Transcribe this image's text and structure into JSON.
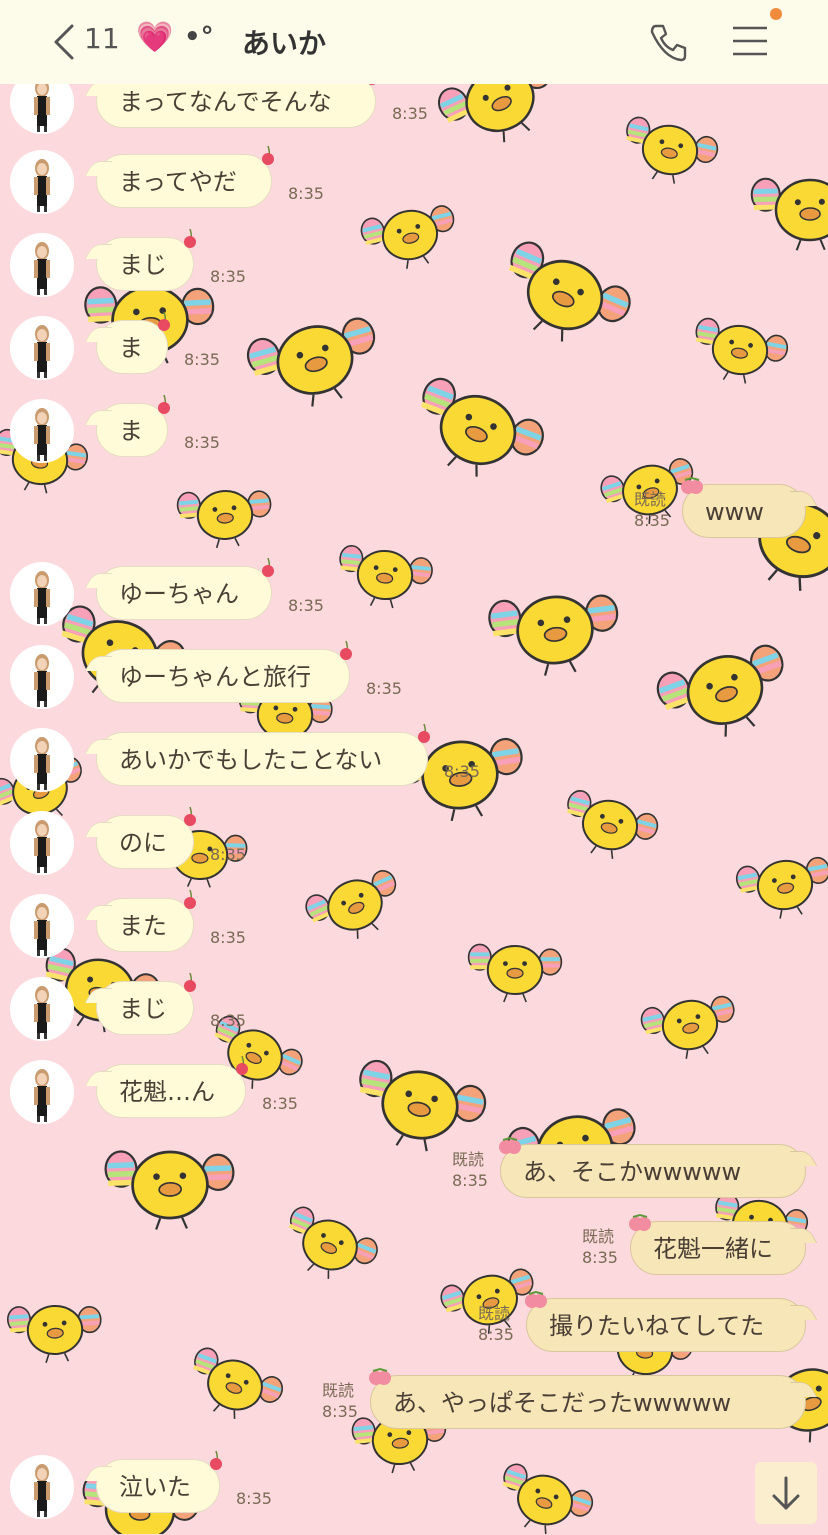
{
  "header": {
    "back_count": "11",
    "heart_emoji": "💗",
    "dots": "•°",
    "title": "あいか",
    "back_icon": "chevron-left-icon",
    "phone_icon": "phone-icon",
    "menu_icon": "hamburger-menu-icon",
    "notification_color": "#f08a3c"
  },
  "theme": {
    "background": "#fcd9dd",
    "header_background": "#fdfbe9",
    "incoming_bubble": "#fffbd9",
    "outgoing_bubble": "#f7e6b8"
  },
  "messages": [
    {
      "dir": "in",
      "text": "まってなんでそんな",
      "time": "8:35"
    },
    {
      "dir": "in",
      "text": "まってやだ",
      "time": "8:35"
    },
    {
      "dir": "in",
      "text": "まじ",
      "time": "8:35"
    },
    {
      "dir": "in",
      "text": "ま",
      "time": "8:35"
    },
    {
      "dir": "in",
      "text": "ま",
      "time": "8:35"
    },
    {
      "dir": "out",
      "text": "www",
      "read": "既読",
      "time": "8:35"
    },
    {
      "dir": "in",
      "text": "ゆーちゃん",
      "time": "8:35"
    },
    {
      "dir": "in",
      "text": "ゆーちゃんと旅行",
      "time": "8:35"
    },
    {
      "dir": "in",
      "text": "あいかでもしたことない",
      "time": "8:35"
    },
    {
      "dir": "in",
      "text": "のに",
      "time": "8:35"
    },
    {
      "dir": "in",
      "text": "また",
      "time": "8:35"
    },
    {
      "dir": "in",
      "text": "まじ",
      "time": "8:35"
    },
    {
      "dir": "in",
      "text": "花魁…ん",
      "time": "8:35"
    },
    {
      "dir": "out",
      "text": "あ、そこかwwwww",
      "read": "既読",
      "time": "8:35"
    },
    {
      "dir": "out",
      "text": "花魁一緒に",
      "read": "既読",
      "time": "8:35"
    },
    {
      "dir": "out",
      "text": "撮りたいねてしてた",
      "read": "既読",
      "time": "8:35"
    },
    {
      "dir": "out",
      "text": "あ、やっぱそこだったwwwww",
      "read": "既読",
      "time": "8:35"
    },
    {
      "dir": "in",
      "text": "泣いた",
      "time": "8:35"
    }
  ],
  "scroll_button_icon": "arrow-down-icon"
}
